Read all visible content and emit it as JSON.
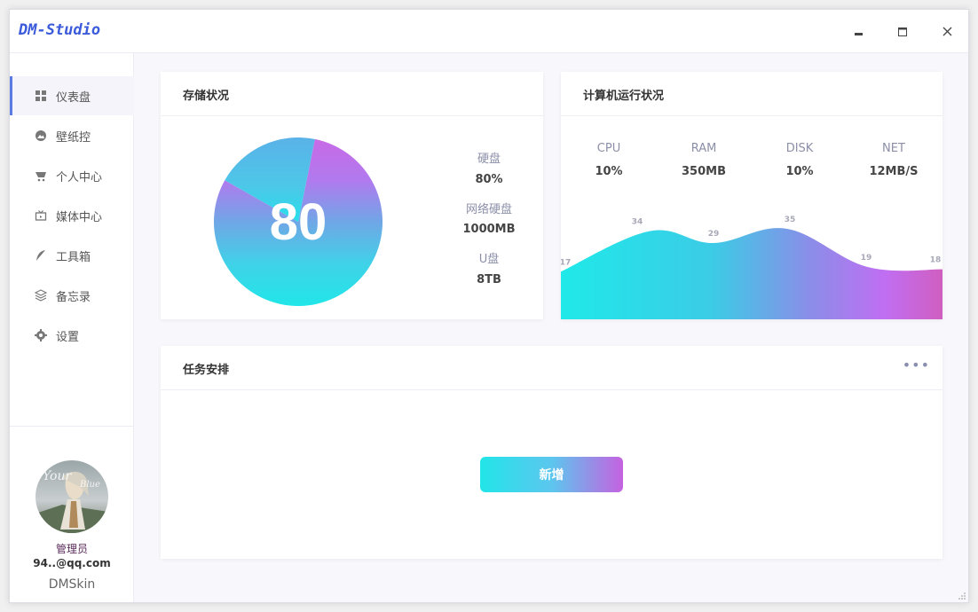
{
  "app": {
    "title": "DM-Studio",
    "controls": {
      "minimize": "▬",
      "maximize": "▭",
      "close": "✕"
    }
  },
  "sidebar": {
    "items": [
      {
        "label": "仪表盘",
        "icon": "dashboard-icon",
        "active": true
      },
      {
        "label": "壁纸控",
        "icon": "image-icon",
        "active": false
      },
      {
        "label": "个人中心",
        "icon": "cart-icon",
        "active": false
      },
      {
        "label": "媒体中心",
        "icon": "tv-icon",
        "active": false
      },
      {
        "label": "工具箱",
        "icon": "feather-icon",
        "active": false
      },
      {
        "label": "备忘录",
        "icon": "layers-icon",
        "active": false
      },
      {
        "label": "设置",
        "icon": "gear-icon",
        "active": false
      }
    ],
    "user": {
      "role": "管理员",
      "email": "94..@qq.com",
      "brand": "DMSkin"
    }
  },
  "storage": {
    "title": "存储状况",
    "center_value": "80",
    "stats": [
      {
        "label": "硬盘",
        "value": "80%"
      },
      {
        "label": "网络硬盘",
        "value": "1000MB"
      },
      {
        "label": "U盘",
        "value": "8TB"
      }
    ]
  },
  "system": {
    "title": "计算机运行状况",
    "stats": [
      {
        "label": "CPU",
        "value": "10%"
      },
      {
        "label": "RAM",
        "value": "350MB"
      },
      {
        "label": "DISK",
        "value": "10%"
      },
      {
        "label": "NET",
        "value": "12MB/S"
      }
    ]
  },
  "tasks": {
    "title": "任务安排",
    "more": "•••",
    "add_label": "新增"
  },
  "colors": {
    "accent": "#5b7be0",
    "gradient_start": "#22e5e8",
    "gradient_end": "#c562e0"
  },
  "chart_data": [
    {
      "type": "pie",
      "slices": [
        {
          "value": 80,
          "color": "#22e5e8"
        },
        {
          "value": 20,
          "color": "#c562e0"
        }
      ],
      "center_label": "80"
    },
    {
      "type": "area",
      "values": [
        17,
        34,
        29,
        35,
        19,
        18
      ],
      "data_labels": [
        "17",
        "34",
        "29",
        "35",
        "19",
        "18"
      ],
      "ylim": [
        0,
        45
      ],
      "grid": false
    }
  ]
}
